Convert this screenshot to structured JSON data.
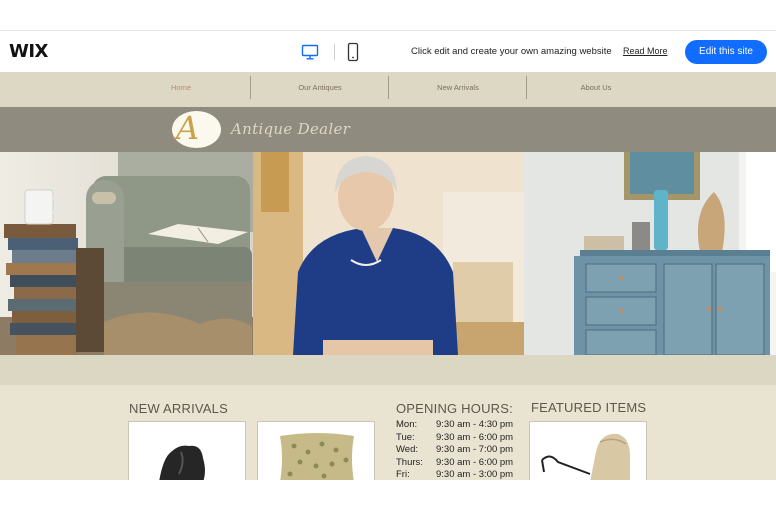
{
  "editor_bar": {
    "logo": "WIX",
    "desktop_icon": "desktop-icon",
    "mobile_icon": "mobile-icon",
    "promo_text": "Click edit and create your own amazing website",
    "read_more": "Read More",
    "edit_button": "Edit this site",
    "accent_color": "#116dff"
  },
  "site": {
    "nav": {
      "items": [
        {
          "label": "Home",
          "active": true
        },
        {
          "label": "Our Antiques",
          "active": false
        },
        {
          "label": "New Arrivals",
          "active": false
        },
        {
          "label": "About Us",
          "active": false
        }
      ]
    },
    "brand": {
      "monogram": "A",
      "name": "Antique Dealer"
    },
    "hero_images": [
      "armchair-books-photo",
      "woman-portrait-photo",
      "blue-cabinet-photo"
    ],
    "sections": {
      "new_arrivals": {
        "title": "NEW ARRIVALS",
        "items": [
          "vase-photo",
          "pillow-photo"
        ]
      },
      "opening_hours": {
        "title": "OPENING HOURS:",
        "rows": [
          {
            "day": "Mon:",
            "time": "9:30 am - 4:30 pm"
          },
          {
            "day": "Tue:",
            "time": "9:30 am - 6:00 pm"
          },
          {
            "day": "Wed:",
            "time": "9:30 am - 7:00 pm"
          },
          {
            "day": "Thurs:",
            "time": "9:30 am - 6:00 pm"
          },
          {
            "day": "Fri:",
            "time": "9:30 am - 3:00 pm"
          }
        ]
      },
      "featured_items": {
        "title": "FEATURED ITEMS",
        "items": [
          "stroller-photo"
        ]
      }
    }
  }
}
